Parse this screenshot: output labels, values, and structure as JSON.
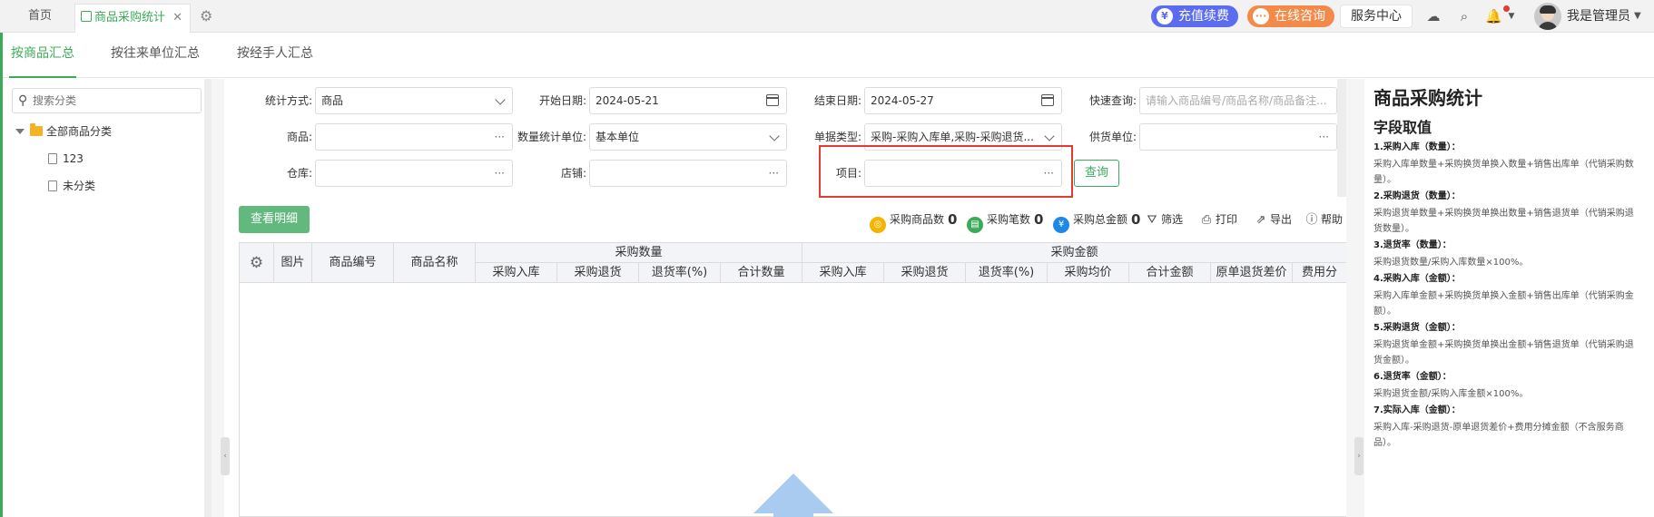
{
  "topbar": {
    "home_tab": "首页",
    "active_tab": "商品采购统计",
    "close": "✕",
    "recharge": "充值续费",
    "consult": "在线咨询",
    "service": "服务中心",
    "user": "我是管理员"
  },
  "subtabs": [
    "按商品汇总",
    "按往来单位汇总",
    "按经手人汇总"
  ],
  "sidebar": {
    "search_placeholder": "搜索分类",
    "root": "全部商品分类",
    "children": [
      "123",
      "未分类"
    ]
  },
  "filters": {
    "stat_mode": {
      "label": "统计方式:",
      "value": "商品"
    },
    "start_date": {
      "label": "开始日期:",
      "value": "2024-05-21"
    },
    "end_date": {
      "label": "结束日期:",
      "value": "2024-05-27"
    },
    "quick_search": {
      "label": "快速查询:",
      "placeholder": "请输入商品编号/商品名称/商品备注..."
    },
    "product": {
      "label": "商品:",
      "value": ""
    },
    "qty_unit": {
      "label": "数量统计单位:",
      "value": "基本单位"
    },
    "doc_type": {
      "label": "单据类型:",
      "value": "采购-采购入库单,采购-采购退货..."
    },
    "supplier": {
      "label": "供货单位:",
      "value": ""
    },
    "warehouse": {
      "label": "仓库:",
      "value": ""
    },
    "store": {
      "label": "店铺:",
      "value": ""
    },
    "project": {
      "label": "项目:",
      "value": ""
    },
    "query_button": "查询",
    "more": "···"
  },
  "toolbar": {
    "detail_button": "查看明细",
    "stats": [
      {
        "label": "采购商品数",
        "value": "0",
        "color": "#f4b400"
      },
      {
        "label": "采购笔数",
        "value": "0",
        "color": "#3bab5a"
      },
      {
        "label": "采购总金额",
        "value": "0",
        "color": "#1e88e5"
      }
    ],
    "filter": "筛选",
    "print": "打印",
    "export": "导出",
    "help": "帮助"
  },
  "table": {
    "fixed_headers": [
      "图片",
      "商品编号",
      "商品名称"
    ],
    "group_qty": "采购数量",
    "qty_cols": [
      "采购入库",
      "采购退货",
      "退货率(%)",
      "合计数量"
    ],
    "group_amount": "采购金额",
    "amount_cols": [
      "采购入库",
      "采购退货",
      "退货率(%)",
      "采购均价",
      "合计金额",
      "原单退货差价",
      "费用分"
    ]
  },
  "help_panel": {
    "title": "商品采购统计",
    "subtitle": "字段取值",
    "items": [
      {
        "h": "1.采购入库（数量）：",
        "d": "采购入库单数量+采购换货单换入数量+销售出库单（代销采购数量）。"
      },
      {
        "h": "2.采购退货（数量）：",
        "d": "采购退货单数量+采购换货单换出数量+销售退货单（代销采购退货数量）。"
      },
      {
        "h": "3.退货率（数量）：",
        "d": "采购退货数量/采购入库数量×100%。"
      },
      {
        "h": "4.采购入库（金额）：",
        "d": "采购入库单金额+采购换货单换入金额+销售出库单（代销采购金额）。"
      },
      {
        "h": "5.采购退货（金额）：",
        "d": "采购退货单金额+采购换货单换出金额+销售退货单（代销采购退货金额）。"
      },
      {
        "h": "6.退货率（金额）：",
        "d": "采购退货金额/采购入库金额×100%。"
      },
      {
        "h": "7.实际入库（金额）：",
        "d": "采购入库-采购退货-原单退货差价+费用分摊金额（不含服务商品）。"
      }
    ]
  }
}
